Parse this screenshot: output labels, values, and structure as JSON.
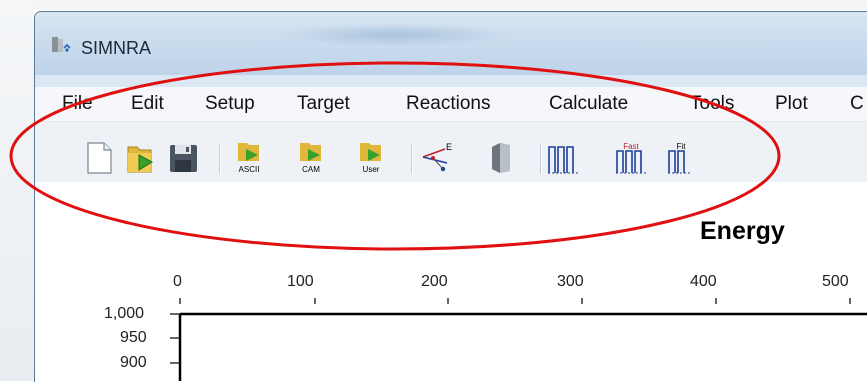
{
  "window": {
    "title": "SIMNRA"
  },
  "menu": {
    "items": [
      "File",
      "Edit",
      "Setup",
      "Target",
      "Reactions",
      "Calculate",
      "Tools",
      "Plot",
      "C"
    ]
  },
  "toolbar": {
    "buttons": [
      {
        "name": "new-file-icon"
      },
      {
        "name": "open-file-icon"
      },
      {
        "name": "save-file-icon"
      },
      {
        "name": "import-ascii-icon",
        "label": "ASCII"
      },
      {
        "name": "import-cam-icon",
        "label": "CAM"
      },
      {
        "name": "import-user-icon",
        "label": "User"
      },
      {
        "name": "energy-calibration-icon",
        "label": "E"
      },
      {
        "name": "target-icon"
      },
      {
        "name": "calculate-spectrum-icon"
      },
      {
        "name": "calculate-spectrum-fast-icon",
        "label": "Fast"
      },
      {
        "name": "fit-spectrum-icon",
        "label": "Fit"
      }
    ]
  },
  "plot": {
    "title": "Energy",
    "top_axis_ticks": [
      "0",
      "100",
      "200",
      "300",
      "400",
      "500"
    ],
    "left_axis_ticks": [
      "1,000",
      "950",
      "900"
    ]
  },
  "annotation": {
    "shape": "ellipse",
    "color": "#e01010"
  },
  "colors": {
    "titlebar": "#cbdcee",
    "menubar": "#f5f7fa",
    "toolbar": "#eef2f6",
    "folder": "#e0b73a",
    "arrow": "#37a12c",
    "annotation": "#e01010"
  }
}
